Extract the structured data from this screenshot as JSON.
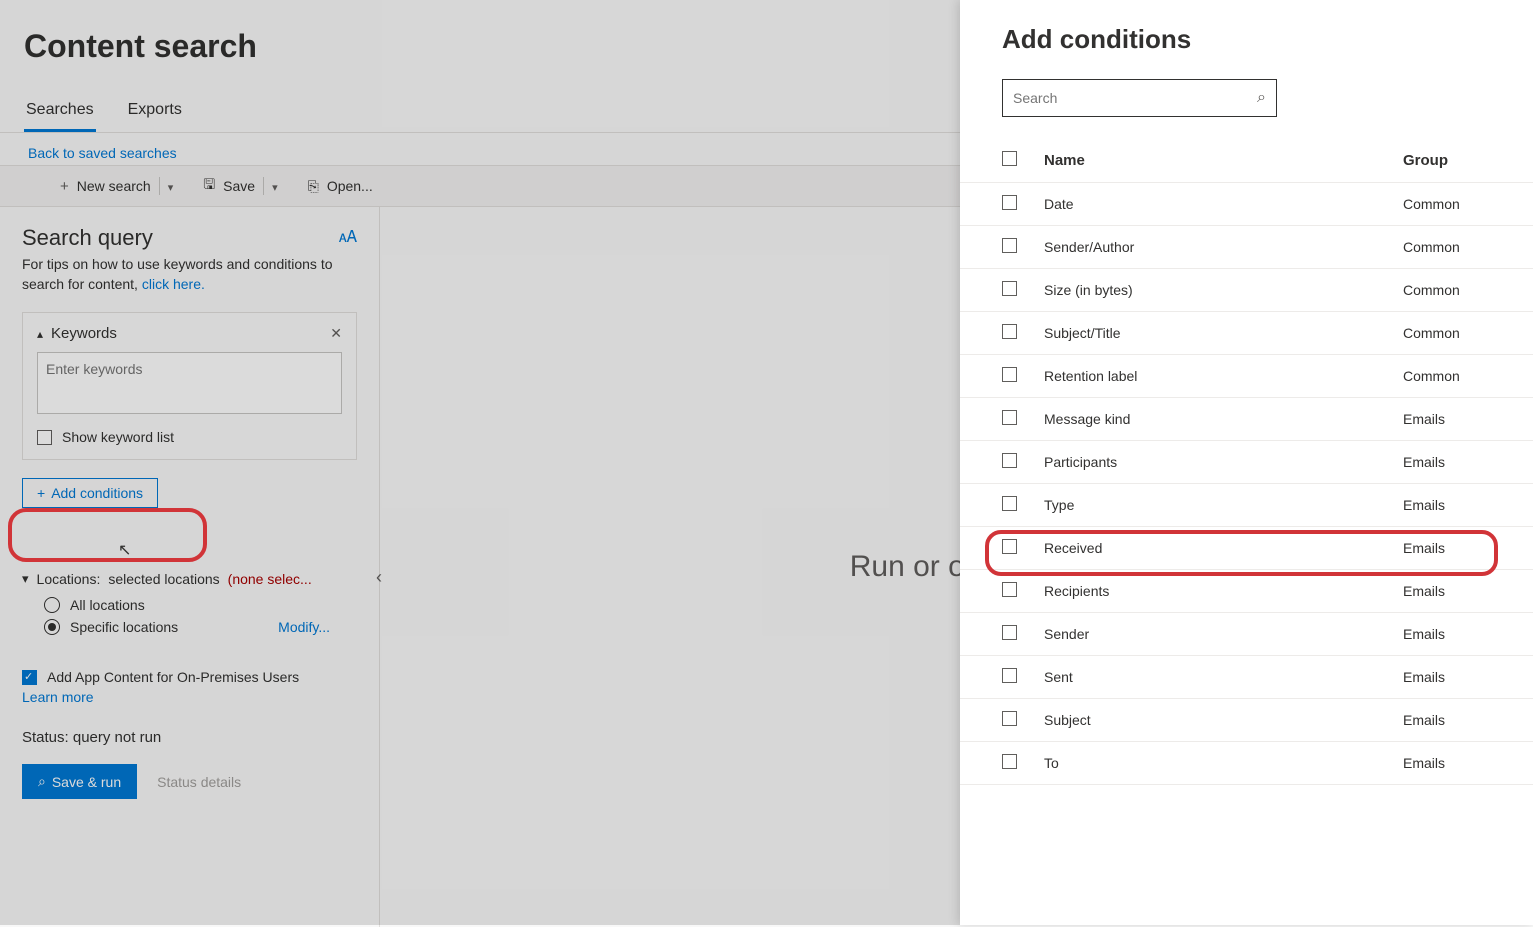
{
  "page_title": "Content search",
  "tabs": {
    "searches": "Searches",
    "exports": "Exports"
  },
  "back_link": "Back to saved searches",
  "toolbar": {
    "new_search": "New search",
    "save": "Save",
    "open": "Open..."
  },
  "search_query": {
    "title": "Search query",
    "tip_prefix": "For tips on how to use keywords and conditions to search for content, ",
    "tip_link": "click here."
  },
  "keywords": {
    "header": "Keywords",
    "placeholder": "Enter keywords",
    "show_list_label": "Show keyword list"
  },
  "add_conditions_btn": "Add conditions",
  "locations": {
    "header_prefix": "Locations: ",
    "header_mid": "selected locations ",
    "header_none": "(none selec...",
    "all": "All locations",
    "specific": "Specific locations",
    "modify": "Modify..."
  },
  "app_content": {
    "label": "Add App Content for On-Premises Users",
    "learn_more": "Learn more"
  },
  "status": {
    "label_prefix": "Status: ",
    "value": "query not run"
  },
  "buttons": {
    "save_run": "Save & run",
    "status_details": "Status details"
  },
  "center_text": "Run or open a s",
  "right_panel": {
    "title": "Add conditions",
    "search_placeholder": "Search",
    "col_name": "Name",
    "col_group": "Group",
    "rows": [
      {
        "name": "Date",
        "group": "Common"
      },
      {
        "name": "Sender/Author",
        "group": "Common"
      },
      {
        "name": "Size (in bytes)",
        "group": "Common"
      },
      {
        "name": "Subject/Title",
        "group": "Common"
      },
      {
        "name": "Retention label",
        "group": "Common"
      },
      {
        "name": "Message kind",
        "group": "Emails"
      },
      {
        "name": "Participants",
        "group": "Emails"
      },
      {
        "name": "Type",
        "group": "Emails"
      },
      {
        "name": "Received",
        "group": "Emails"
      },
      {
        "name": "Recipients",
        "group": "Emails"
      },
      {
        "name": "Sender",
        "group": "Emails"
      },
      {
        "name": "Sent",
        "group": "Emails"
      },
      {
        "name": "Subject",
        "group": "Emails"
      },
      {
        "name": "To",
        "group": "Emails"
      }
    ]
  }
}
